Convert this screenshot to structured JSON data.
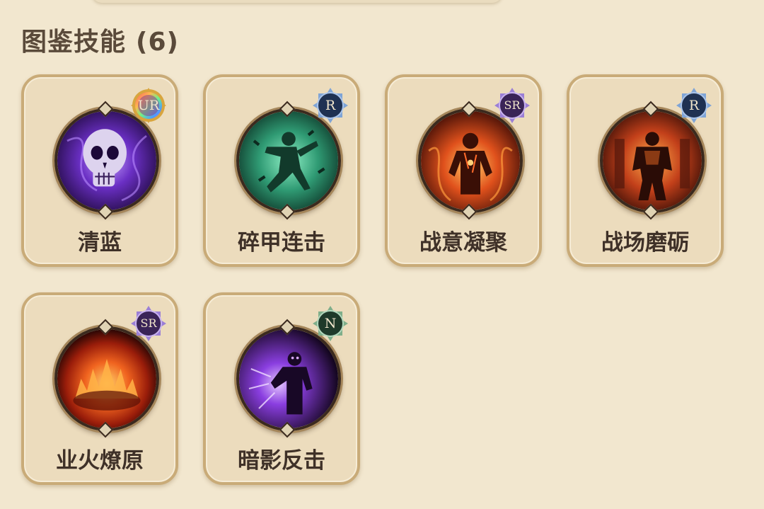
{
  "section": {
    "title": "图鉴技能",
    "count": "(6)"
  },
  "colors": {
    "background": "#f2e7cf",
    "card": "#ecdcbd",
    "card_border": "#c9ab78",
    "title_text": "#5a4a3a"
  },
  "skills": [
    {
      "name": "清蓝",
      "rarity": "UR",
      "portrait_icon": "purple-skull-icon"
    },
    {
      "name": "碎甲连击",
      "rarity": "R",
      "portrait_icon": "green-warrior-strike-icon"
    },
    {
      "name": "战意凝聚",
      "rarity": "SR",
      "portrait_icon": "fire-warrior-icon"
    },
    {
      "name": "战场磨砺",
      "rarity": "R",
      "portrait_icon": "armored-warrior-icon"
    },
    {
      "name": "业火燎原",
      "rarity": "SR",
      "portrait_icon": "hellfire-icon"
    },
    {
      "name": "暗影反击",
      "rarity": "N",
      "portrait_icon": "shadow-warrior-icon"
    }
  ]
}
